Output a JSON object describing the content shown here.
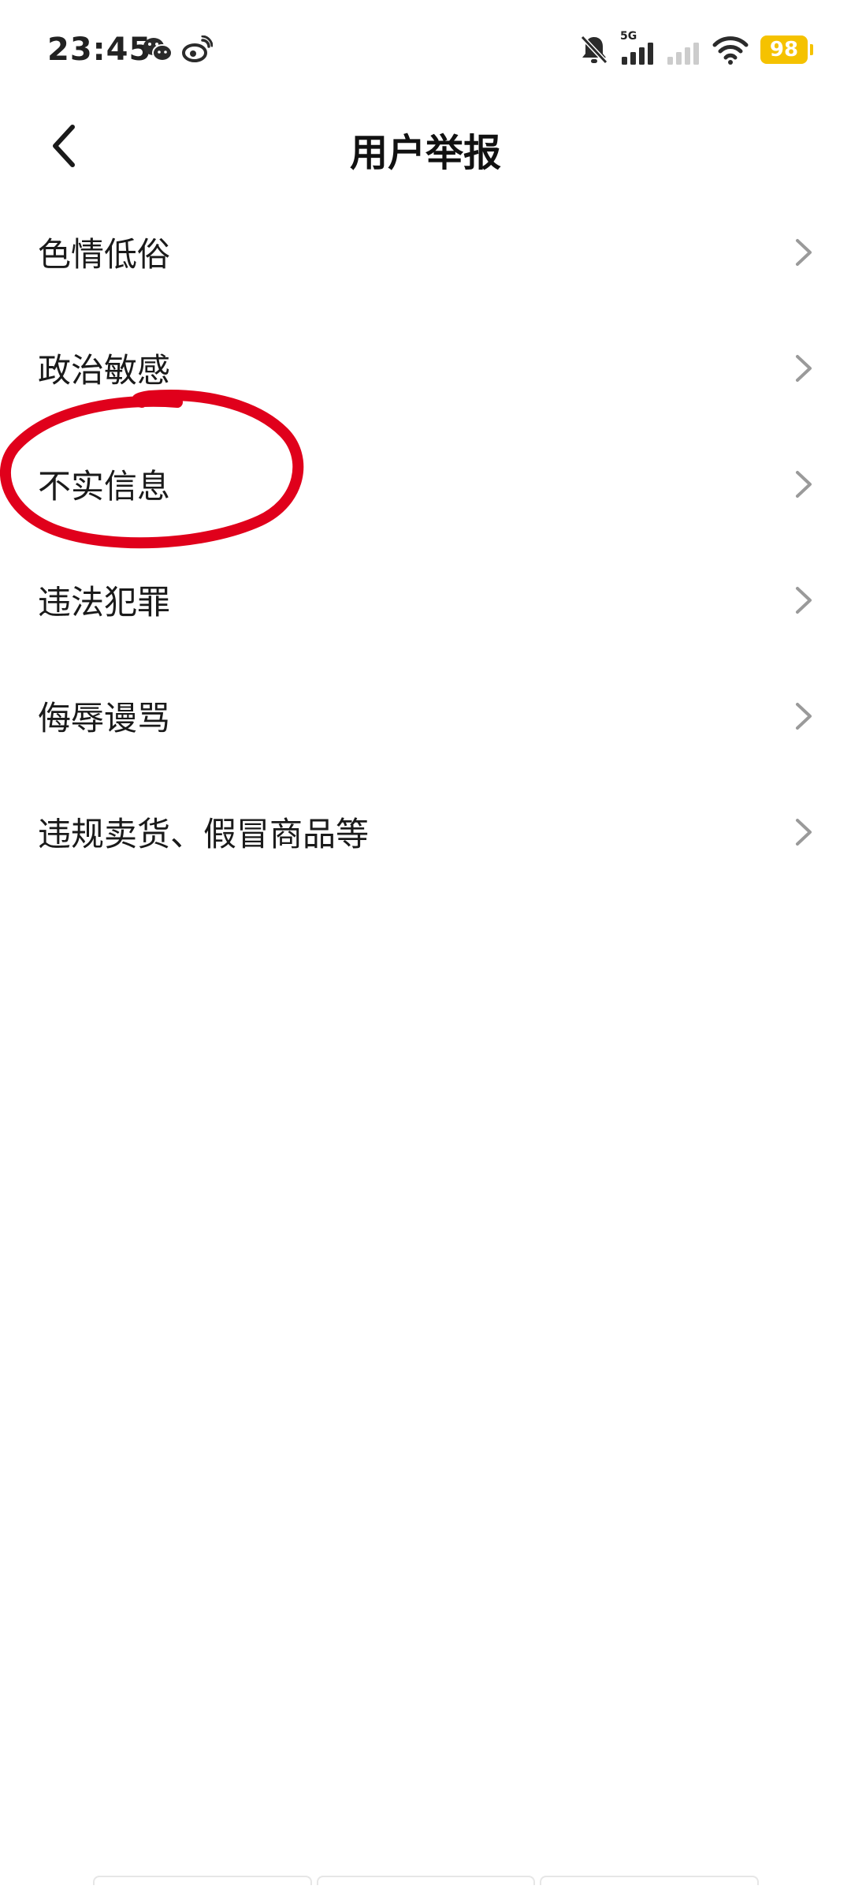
{
  "status_bar": {
    "time": "23:45",
    "network_label": "5G",
    "battery": "98",
    "icons": [
      "wechat-icon",
      "weibo-icon",
      "mute-bell-icon",
      "signal-5g-icon",
      "signal-icon",
      "wifi-icon",
      "battery-icon"
    ],
    "battery_color": "#f5c200"
  },
  "header": {
    "title": "用户举报",
    "back_icon": "chevron-left-icon"
  },
  "report_items": [
    {
      "label": "色情低俗"
    },
    {
      "label": "政治敏感"
    },
    {
      "label": "不实信息"
    },
    {
      "label": "违法犯罪"
    },
    {
      "label": "侮辱谩骂"
    },
    {
      "label": "违规卖货、假冒商品等"
    }
  ],
  "annotation": {
    "color": "#e0001b",
    "target_item": "不实信息"
  }
}
